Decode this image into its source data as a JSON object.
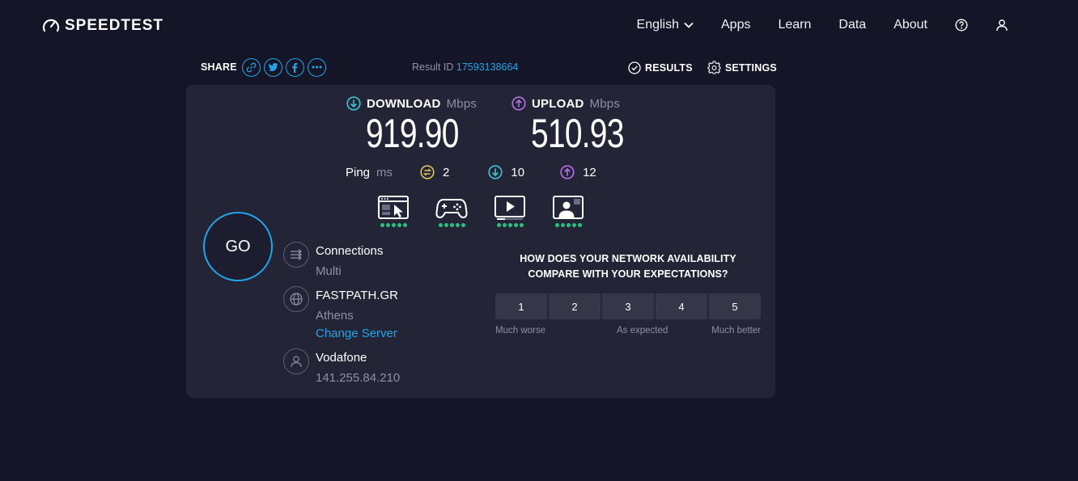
{
  "brand": {
    "name": "SPEEDTEST"
  },
  "nav": {
    "language": "English",
    "items": [
      "Apps",
      "Learn",
      "Data",
      "About"
    ]
  },
  "share": {
    "label": "SHARE",
    "buttons": [
      "link-icon",
      "twitter-icon",
      "facebook-icon",
      "more-icon"
    ]
  },
  "result": {
    "label": "Result ID",
    "id": "17593138664"
  },
  "links": {
    "results": "RESULTS",
    "settings": "SETTINGS"
  },
  "download": {
    "label": "DOWNLOAD",
    "unit": "Mbps",
    "value": "919.90"
  },
  "upload": {
    "label": "UPLOAD",
    "unit": "Mbps",
    "value": "510.93"
  },
  "ping": {
    "label": "Ping",
    "unit": "ms",
    "idle": "2",
    "download": "10",
    "upload": "12"
  },
  "usecases": [
    {
      "icon": "browsing-icon",
      "rating": 5
    },
    {
      "icon": "gaming-icon",
      "rating": 5
    },
    {
      "icon": "streaming-icon",
      "rating": 5
    },
    {
      "icon": "video-call-icon",
      "rating": 5
    }
  ],
  "go": {
    "label": "GO"
  },
  "connections": {
    "title": "Connections",
    "value": "Multi"
  },
  "server": {
    "name": "FASTPATH.GR",
    "location": "Athens",
    "change_label": "Change Server"
  },
  "provider": {
    "name": "Vodafone",
    "ip": "141.255.84.210"
  },
  "survey": {
    "question_line1": "HOW DOES YOUR NETWORK AVAILABILITY",
    "question_line2": "COMPARE WITH YOUR EXPECTATIONS?",
    "options": [
      "1",
      "2",
      "3",
      "4",
      "5"
    ],
    "low_label": "Much worse",
    "mid_label": "As expected",
    "high_label": "Much better"
  },
  "colors": {
    "background": "#141526",
    "panel": "#232537",
    "accent_blue": "#1fa5e8",
    "download_teal": "#3cc7d6",
    "upload_purple": "#b770e8",
    "idle_yellow": "#e6c25a",
    "rating_green": "#26c281"
  }
}
